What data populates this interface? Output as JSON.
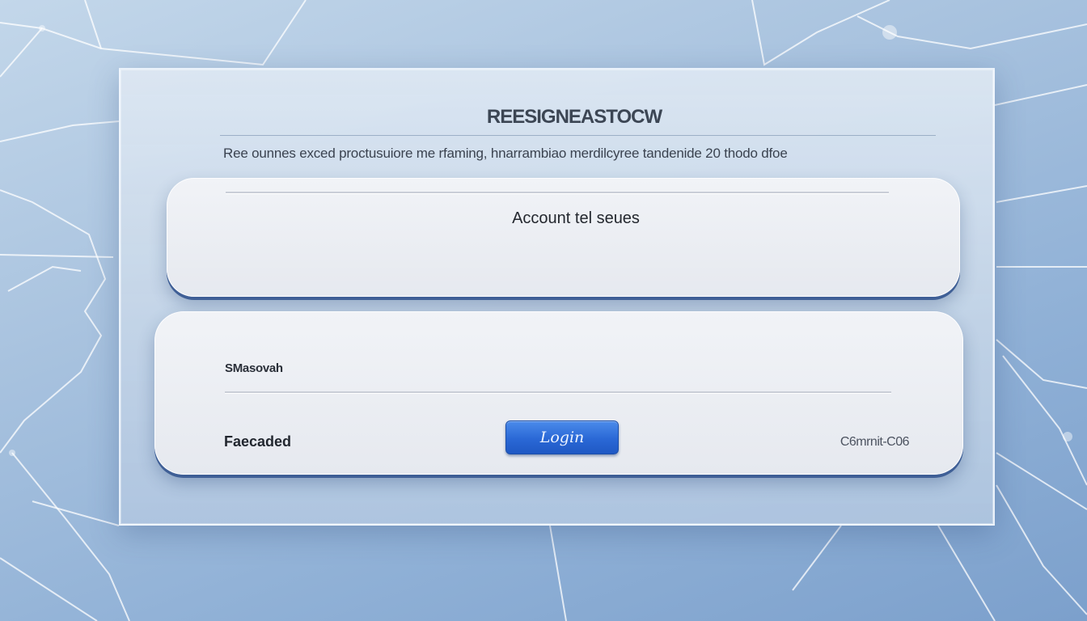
{
  "header": {
    "title": "REESIGNEASTOCW",
    "subtitle": "Ree ounnes exced proctusuiore me rfaming, hnarrambiao merdilcyree tandenide 20 thodo dfoe"
  },
  "account_card": {
    "label": "Account tel seues"
  },
  "login_card": {
    "field_label": "SMasovah",
    "footer_left": "Faecaded",
    "login_button_label": "Login",
    "footer_right": "C6mrnit-C06"
  },
  "colors": {
    "accent": "#2a68d6",
    "background": "#a9c3df",
    "card": "#eceef3"
  }
}
